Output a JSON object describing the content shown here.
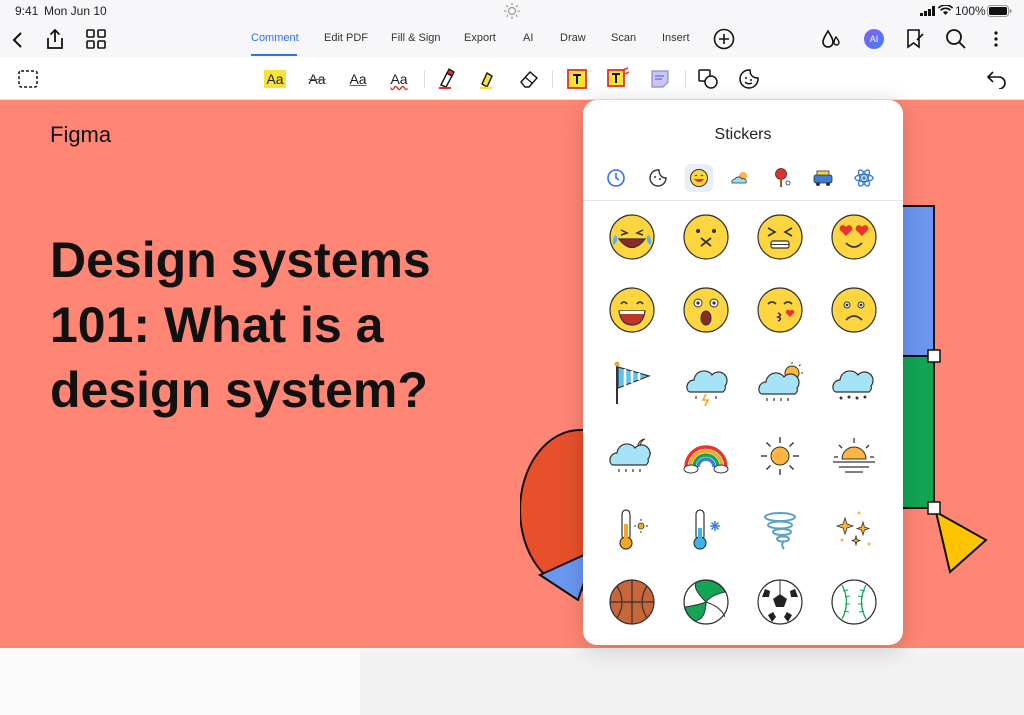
{
  "status": {
    "time": "9:41",
    "date": "Mon Jun 10",
    "battery": "100%"
  },
  "nav": {
    "tabs": [
      {
        "label": "Comment",
        "active": true
      },
      {
        "label": "Edit PDF"
      },
      {
        "label": "Fill & Sign"
      },
      {
        "label": "Export"
      },
      {
        "label": "AI"
      },
      {
        "label": "Draw"
      },
      {
        "label": "Scan"
      },
      {
        "label": "Insert"
      }
    ],
    "ai_badge": "AI"
  },
  "toolbar": {
    "text_tool_label": "Aa"
  },
  "doc": {
    "brand": "Figma",
    "headline_1": "Design systems",
    "headline_2": "101: What is a",
    "headline_3": "design system?"
  },
  "panel": {
    "title": "Stickers",
    "categories": [
      "recent",
      "sticker",
      "emoji",
      "weather",
      "sports",
      "travel",
      "science"
    ],
    "selected_category": "emoji",
    "stickers": [
      [
        "laughing-tears",
        "dizzy-face",
        "squinting-face",
        "heart-eyes"
      ],
      [
        "grinning-face",
        "surprised-face",
        "kissing-face",
        "sad-face"
      ],
      [
        "flag",
        "storm-cloud",
        "sun-cloud-rain",
        "snow-cloud"
      ],
      [
        "moon-cloud-rain",
        "rainbow",
        "sun",
        "sunset"
      ],
      [
        "thermometer-hot",
        "thermometer-cold",
        "tornado",
        "sparkles"
      ],
      [
        "basketball",
        "volleyball",
        "soccer-ball",
        "baseball"
      ]
    ]
  },
  "colors": {
    "accent": "#2f6ff0",
    "doc_bg": "#ff8674",
    "emoji_yellow": "#fcd53f"
  }
}
